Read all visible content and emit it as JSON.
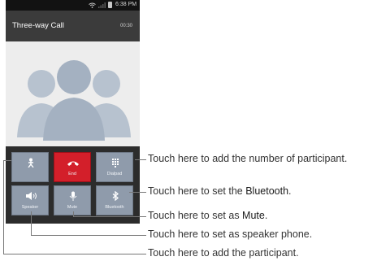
{
  "status_bar": {
    "time": "6:38 PM",
    "icons": [
      "wifi-icon",
      "signal-icon",
      "battery-icon"
    ]
  },
  "call": {
    "title": "Three-way Call",
    "timer": "00:30"
  },
  "controls": [
    {
      "id": "add-call",
      "label": "",
      "icon": "add-participant-icon",
      "color": "#8f9bab"
    },
    {
      "id": "end",
      "label": "End",
      "icon": "end-call-icon",
      "color": "#d31f2a"
    },
    {
      "id": "dialpad",
      "label": "Dialpad",
      "icon": "dialpad-icon",
      "color": "#8f9bab"
    },
    {
      "id": "speaker",
      "label": "Speaker",
      "icon": "speaker-icon",
      "color": "#8f9bab"
    },
    {
      "id": "mute",
      "label": "Mute",
      "icon": "microphone-icon",
      "color": "#8f9bab"
    },
    {
      "id": "bluetooth",
      "label": "Bluetooth",
      "icon": "bluetooth-icon",
      "color": "#8f9bab"
    }
  ],
  "callouts": {
    "dialpad": "Touch here to add the number of participant.",
    "bluetooth_prefix": "Touch here to set the ",
    "bluetooth_term": "Bluetooth",
    "bluetooth_suffix": ".",
    "mute_prefix": "Touch here to set as ",
    "mute_term": "Mute",
    "mute_suffix": ".",
    "speaker": "Touch here to set as speaker phone.",
    "add_participant": "Touch here to add the participant."
  }
}
